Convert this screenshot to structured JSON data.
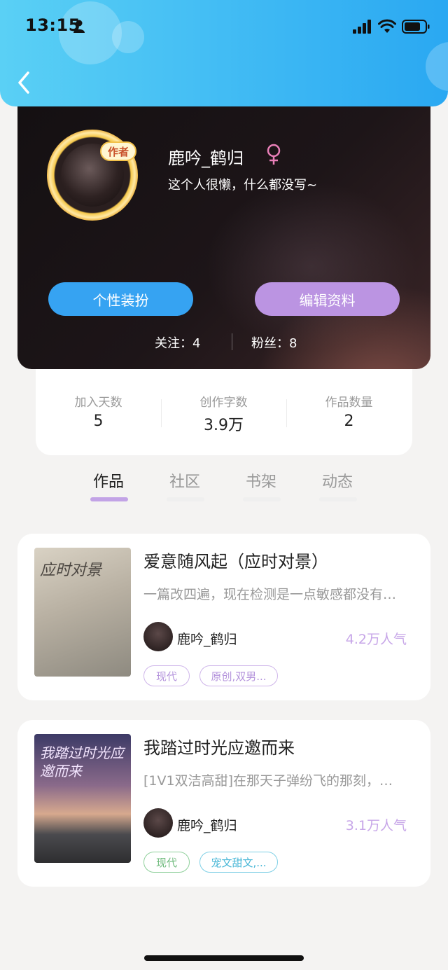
{
  "status_bar": {
    "time": "13:15"
  },
  "profile": {
    "badge": "作者",
    "username": "鹿吟_鹤归",
    "bio": "这个人很懒，什么都没写~",
    "dressup_label": "个性装扮",
    "edit_label": "编辑资料",
    "follow_text": "关注：4",
    "fans_text": "粉丝：8"
  },
  "stats": [
    {
      "label": "加入天数",
      "value": "5"
    },
    {
      "label": "创作字数",
      "value": "3.9万"
    },
    {
      "label": "作品数量",
      "value": "2"
    }
  ],
  "tabs": [
    {
      "label": "作品",
      "active": true
    },
    {
      "label": "社区",
      "active": false
    },
    {
      "label": "书架",
      "active": false
    },
    {
      "label": "动态",
      "active": false
    }
  ],
  "works": [
    {
      "cover_text": "应时对景",
      "title": "爱意随风起（应时对景）",
      "description": "一篇改四遍，现在检测是一点敏感都没有…",
      "author": "鹿吟_鹤归",
      "popularity": "4.2万人气",
      "tags": [
        "现代",
        "原创,双男..."
      ]
    },
    {
      "cover_text": "我踏过时光应邀而来",
      "title": "我踏过时光应邀而来",
      "description": "[1V1双洁高甜]在那天子弹纷飞的那刻，…",
      "author": "鹿吟_鹤归",
      "popularity": "3.1万人气",
      "tags": [
        "现代",
        "宠文甜文,..."
      ]
    }
  ],
  "colors": {
    "header_start": "#5ad0f5",
    "header_end": "#2aa8f2",
    "dressup_button": "#36a3f2",
    "edit_button": "#bb94e2",
    "tab_underline": "#c2a3e6",
    "popularity": "#c7a6e8"
  }
}
